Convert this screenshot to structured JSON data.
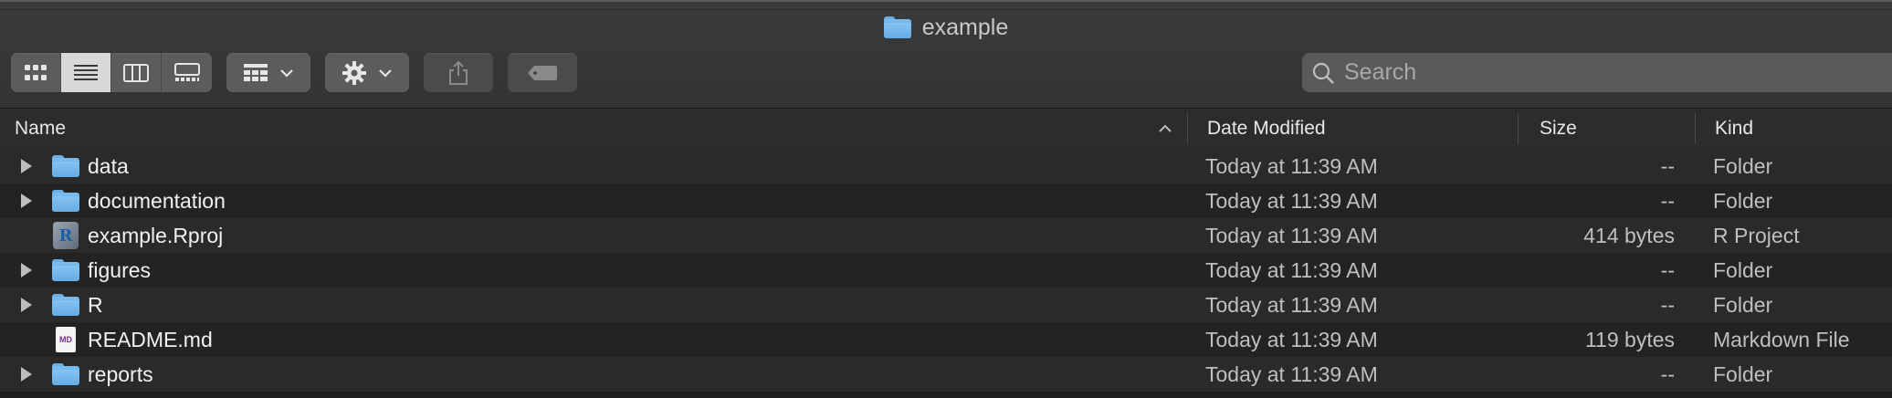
{
  "window": {
    "title": "example"
  },
  "toolbar": {
    "view_modes": [
      {
        "name": "icon-view",
        "active": false
      },
      {
        "name": "list-view",
        "active": true
      },
      {
        "name": "column-view",
        "active": false
      },
      {
        "name": "gallery-view",
        "active": false
      }
    ],
    "buttons": [
      "group-by",
      "action-gear",
      "share",
      "tags"
    ]
  },
  "search": {
    "placeholder": "Search",
    "value": ""
  },
  "columns": {
    "name": "Name",
    "date_modified": "Date Modified",
    "size": "Size",
    "kind": "Kind",
    "sort_direction": "ascending"
  },
  "files": [
    {
      "name": "data",
      "type": "folder",
      "date": "Today at 11:39 AM",
      "size": "--",
      "kind": "Folder"
    },
    {
      "name": "documentation",
      "type": "folder",
      "date": "Today at 11:39 AM",
      "size": "--",
      "kind": "Folder"
    },
    {
      "name": "example.Rproj",
      "type": "rproj",
      "icon_label": "R",
      "date": "Today at 11:39 AM",
      "size": "414 bytes",
      "kind": "R Project"
    },
    {
      "name": "figures",
      "type": "folder",
      "date": "Today at 11:39 AM",
      "size": "--",
      "kind": "Folder"
    },
    {
      "name": "R",
      "type": "folder",
      "date": "Today at 11:39 AM",
      "size": "--",
      "kind": "Folder"
    },
    {
      "name": "README.md",
      "type": "markdown",
      "icon_label": "MD",
      "date": "Today at 11:39 AM",
      "size": "119 bytes",
      "kind": "Markdown File"
    },
    {
      "name": "reports",
      "type": "folder",
      "date": "Today at 11:39 AM",
      "size": "--",
      "kind": "Folder"
    }
  ],
  "colors": {
    "folder_blue": "#6aaee6",
    "active_segment": "#d8d8d8",
    "background": "#1f1f1f"
  }
}
